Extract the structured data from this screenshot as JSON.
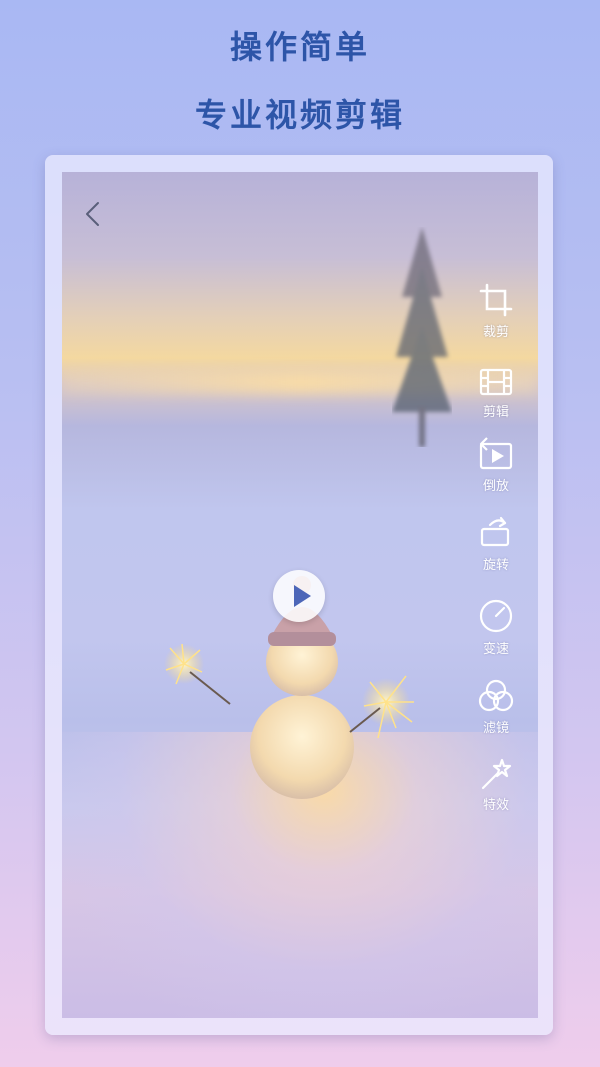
{
  "promo": {
    "line1": "操作简单",
    "line2": "专业视频剪辑"
  },
  "editor": {
    "back_icon": "chevron-left-icon",
    "play_icon": "play-icon",
    "tools": [
      {
        "label": "裁剪",
        "icon": "crop-icon"
      },
      {
        "label": "剪辑",
        "icon": "film-icon"
      },
      {
        "label": "倒放",
        "icon": "reverse-icon"
      },
      {
        "label": "旋转",
        "icon": "rotate-icon"
      },
      {
        "label": "变速",
        "icon": "speed-icon"
      },
      {
        "label": "滤镜",
        "icon": "filter-icon"
      },
      {
        "label": "特效",
        "icon": "magic-wand-icon"
      }
    ]
  },
  "colors": {
    "headline": "#2d55a8",
    "play_icon": "#4c66b8",
    "tool_text": "#ffffff"
  }
}
